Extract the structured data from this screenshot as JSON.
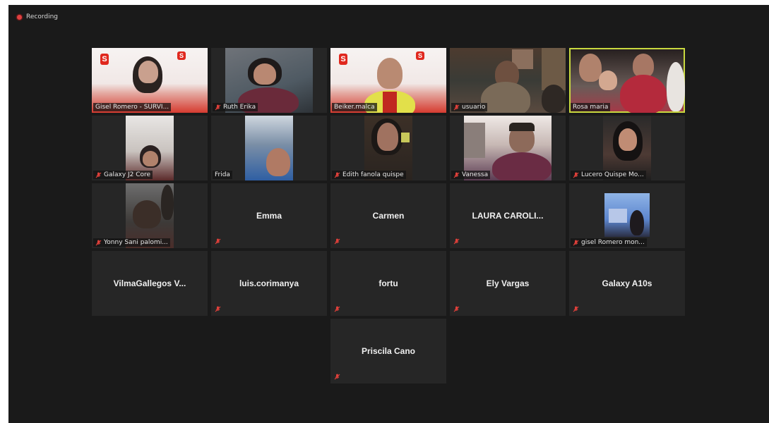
{
  "recording": {
    "label": "Recording"
  },
  "participants": [
    {
      "name": "Gisel Romero - SURVI...",
      "muted": false,
      "active": false
    },
    {
      "name": "Ruth Erika",
      "muted": true,
      "active": false
    },
    {
      "name": "Beiker.malca",
      "muted": false,
      "active": false
    },
    {
      "name": "usuario",
      "muted": true,
      "active": false
    },
    {
      "name": "Rosa maria",
      "muted": false,
      "active": true
    },
    {
      "name": "Galaxy J2 Core",
      "muted": true,
      "active": false
    },
    {
      "name": "Frida",
      "muted": false,
      "active": false
    },
    {
      "name": "Edith fanola quispe",
      "muted": true,
      "active": false
    },
    {
      "name": "Vanessa",
      "muted": true,
      "active": false
    },
    {
      "name": "Lucero Quispe Mo...",
      "muted": true,
      "active": false
    },
    {
      "name": "Yonny Sani palomi...",
      "muted": true,
      "active": false
    },
    {
      "name": "Emma",
      "muted": true,
      "active": false
    },
    {
      "name": "Carmen",
      "muted": true,
      "active": false
    },
    {
      "name": "LAURA CAROLI...",
      "muted": true,
      "active": false
    },
    {
      "name": "gisel Romero mon...",
      "muted": true,
      "active": false
    },
    {
      "name": "VilmaGallegos  V...",
      "muted": false,
      "active": false
    },
    {
      "name": "luis.corimanya",
      "muted": true,
      "active": false
    },
    {
      "name": "fortu",
      "muted": true,
      "active": false
    },
    {
      "name": "Ely Vargas",
      "muted": true,
      "active": false
    },
    {
      "name": "Galaxy A10s",
      "muted": true,
      "active": false
    },
    {
      "name": "Priscila Cano",
      "muted": true,
      "active": false
    }
  ],
  "colors": {
    "background": "#1a1a1a",
    "tile": "#262626",
    "active_border": "#c9d93f",
    "mute_icon": "#e0403a"
  },
  "logo_letter": "S"
}
